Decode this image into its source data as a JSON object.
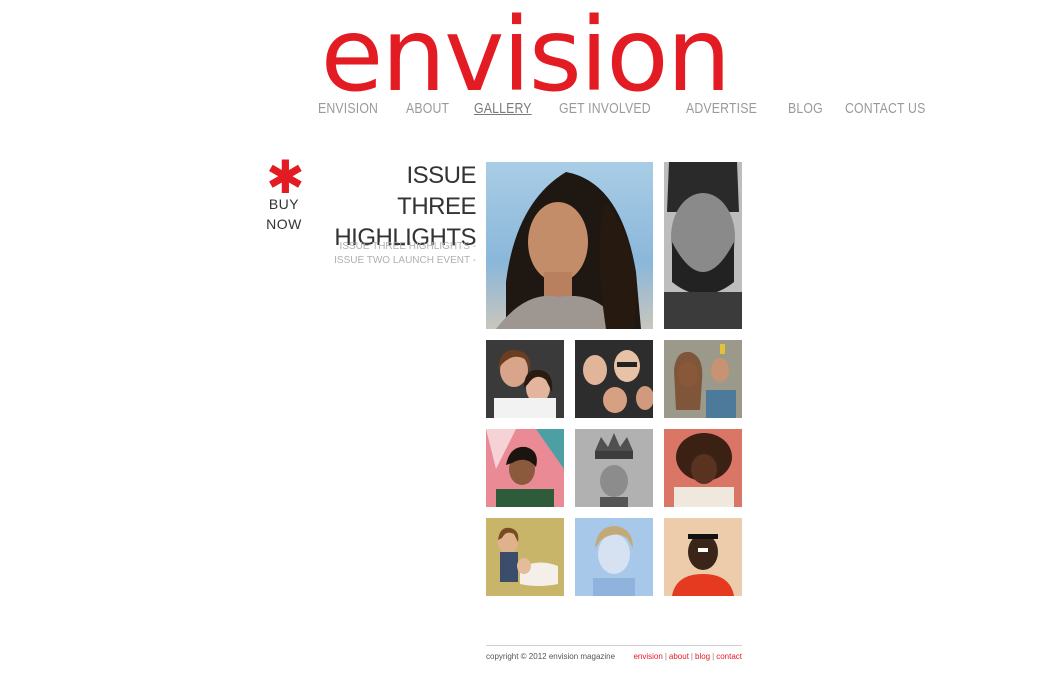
{
  "brand": {
    "logo": "envision",
    "accent": "#e31b23"
  },
  "nav": {
    "items": [
      {
        "label": "ENVISION"
      },
      {
        "label": "ABOUT"
      },
      {
        "label": "GALLERY",
        "active": true
      },
      {
        "label": "GET INVOLVED"
      },
      {
        "label": "ADVERTISE"
      },
      {
        "label": "BLOG"
      },
      {
        "label": "CONTACT US"
      }
    ]
  },
  "buy": {
    "line1": "BUY",
    "line2": "NOW"
  },
  "gallery": {
    "title_line1": "ISSUE THREE",
    "title_line2": "HIGHLIGHTS",
    "links": [
      {
        "label": "ISSUE THREE HIGHLIGHTS -"
      },
      {
        "label": "ISSUE TWO LAUNCH EVENT -"
      }
    ]
  },
  "footer": {
    "copyright": "copyright © 2012 envision magazine",
    "links": [
      "envision",
      "about",
      "blog",
      "contact"
    ],
    "separator": "|"
  }
}
